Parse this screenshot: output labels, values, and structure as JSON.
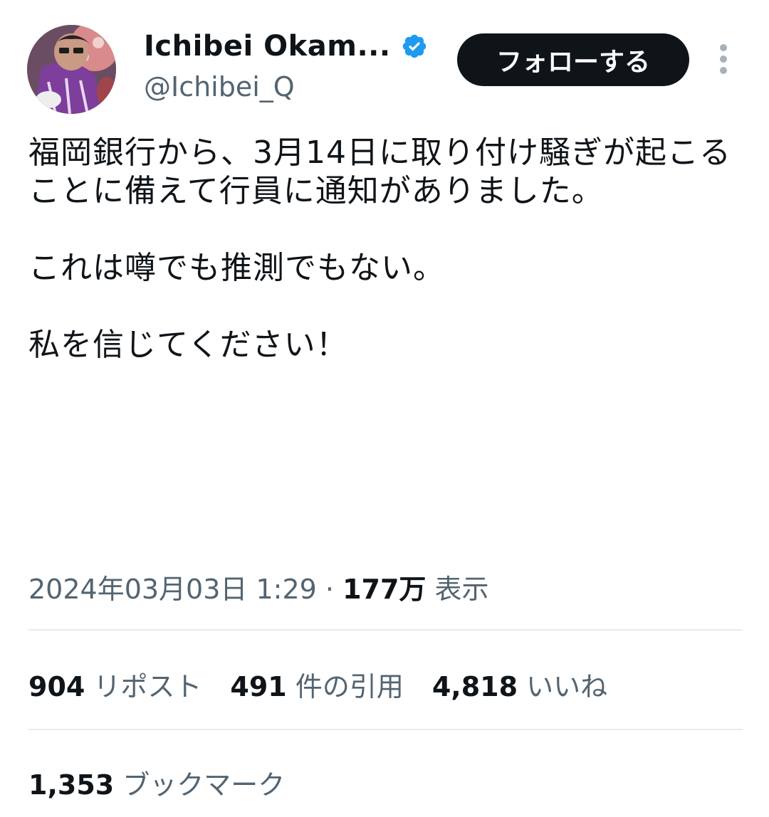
{
  "author": {
    "name": "Ichibei Okam...",
    "handle": "@Ichibei_Q",
    "verified": true,
    "verified_color": "#1d9bf0"
  },
  "follow_button": {
    "label": "フォローする",
    "bg": "#0f1419",
    "color": "#ffffff"
  },
  "tweet": {
    "text": "福岡銀行から、3月14日に取り付け騒ぎが起こることに備えて行員に通知がありました。\n\nこれは噂でも推測でもない。\n\n私を信じてください！"
  },
  "meta": {
    "datetime": "2024年03月03日 1:29",
    "separator": " · ",
    "views_count": "177万",
    "views_label": " 表示"
  },
  "stats": {
    "reposts": {
      "count": "904",
      "label": " リポスト"
    },
    "quotes": {
      "count": "491",
      "label": " 件の引用"
    },
    "likes": {
      "count": "4,818",
      "label": " いいね"
    },
    "bookmarks": {
      "count": "1,353",
      "label": " ブックマーク"
    }
  },
  "icons": {
    "verified": "verified-badge-icon",
    "more": "more-options-icon",
    "avatar": "profile-avatar"
  }
}
